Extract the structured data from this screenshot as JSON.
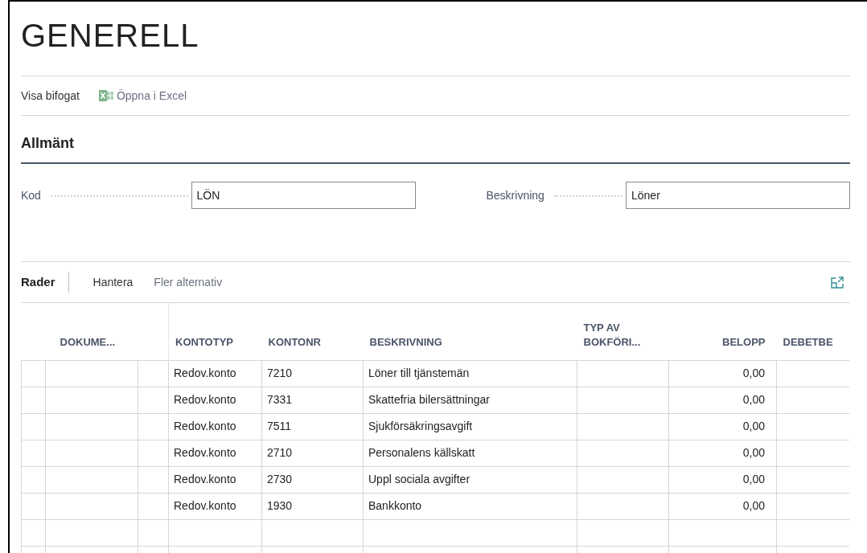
{
  "page_title": "GENERELL",
  "actions": [
    {
      "kind": "text",
      "label": "Visa bifogat"
    },
    {
      "kind": "excel",
      "label": "Öppna i Excel"
    }
  ],
  "section": {
    "title": "Allmänt",
    "fields": [
      {
        "label": "Kod",
        "value": "LÖN"
      },
      {
        "label": "Beskrivning",
        "value": "Löner"
      }
    ]
  },
  "lines": {
    "title": "Rader",
    "actions": [
      {
        "label": "Hantera",
        "kind": "primary"
      },
      {
        "label": "Fler alternativ",
        "kind": "muted"
      }
    ],
    "columns": [
      "DOKUME...",
      "KONTOTYP",
      "KONTONR",
      "BESKRIVNING",
      "TYP AV BOKFÖRI...",
      "BELOPP",
      "DEBETBE"
    ],
    "rows": [
      {
        "kontotyp": "Redov.konto",
        "kontonr": "7210",
        "beskrivning": "Löner till tjänstemän",
        "belopp": "0,00"
      },
      {
        "kontotyp": "Redov.konto",
        "kontonr": "7331",
        "beskrivning": "Skattefria bilersättningar",
        "belopp": "0,00"
      },
      {
        "kontotyp": "Redov.konto",
        "kontonr": "7511",
        "beskrivning": "Sjukförsäkringsavgift",
        "belopp": "0,00"
      },
      {
        "kontotyp": "Redov.konto",
        "kontonr": "2710",
        "beskrivning": "Personalens källskatt",
        "belopp": "0,00"
      },
      {
        "kontotyp": "Redov.konto",
        "kontonr": "2730",
        "beskrivning": "Uppl sociala avgifter",
        "belopp": "0,00"
      },
      {
        "kontotyp": "Redov.konto",
        "kontonr": "1930",
        "beskrivning": "Bankkonto",
        "belopp": "0,00"
      }
    ]
  }
}
